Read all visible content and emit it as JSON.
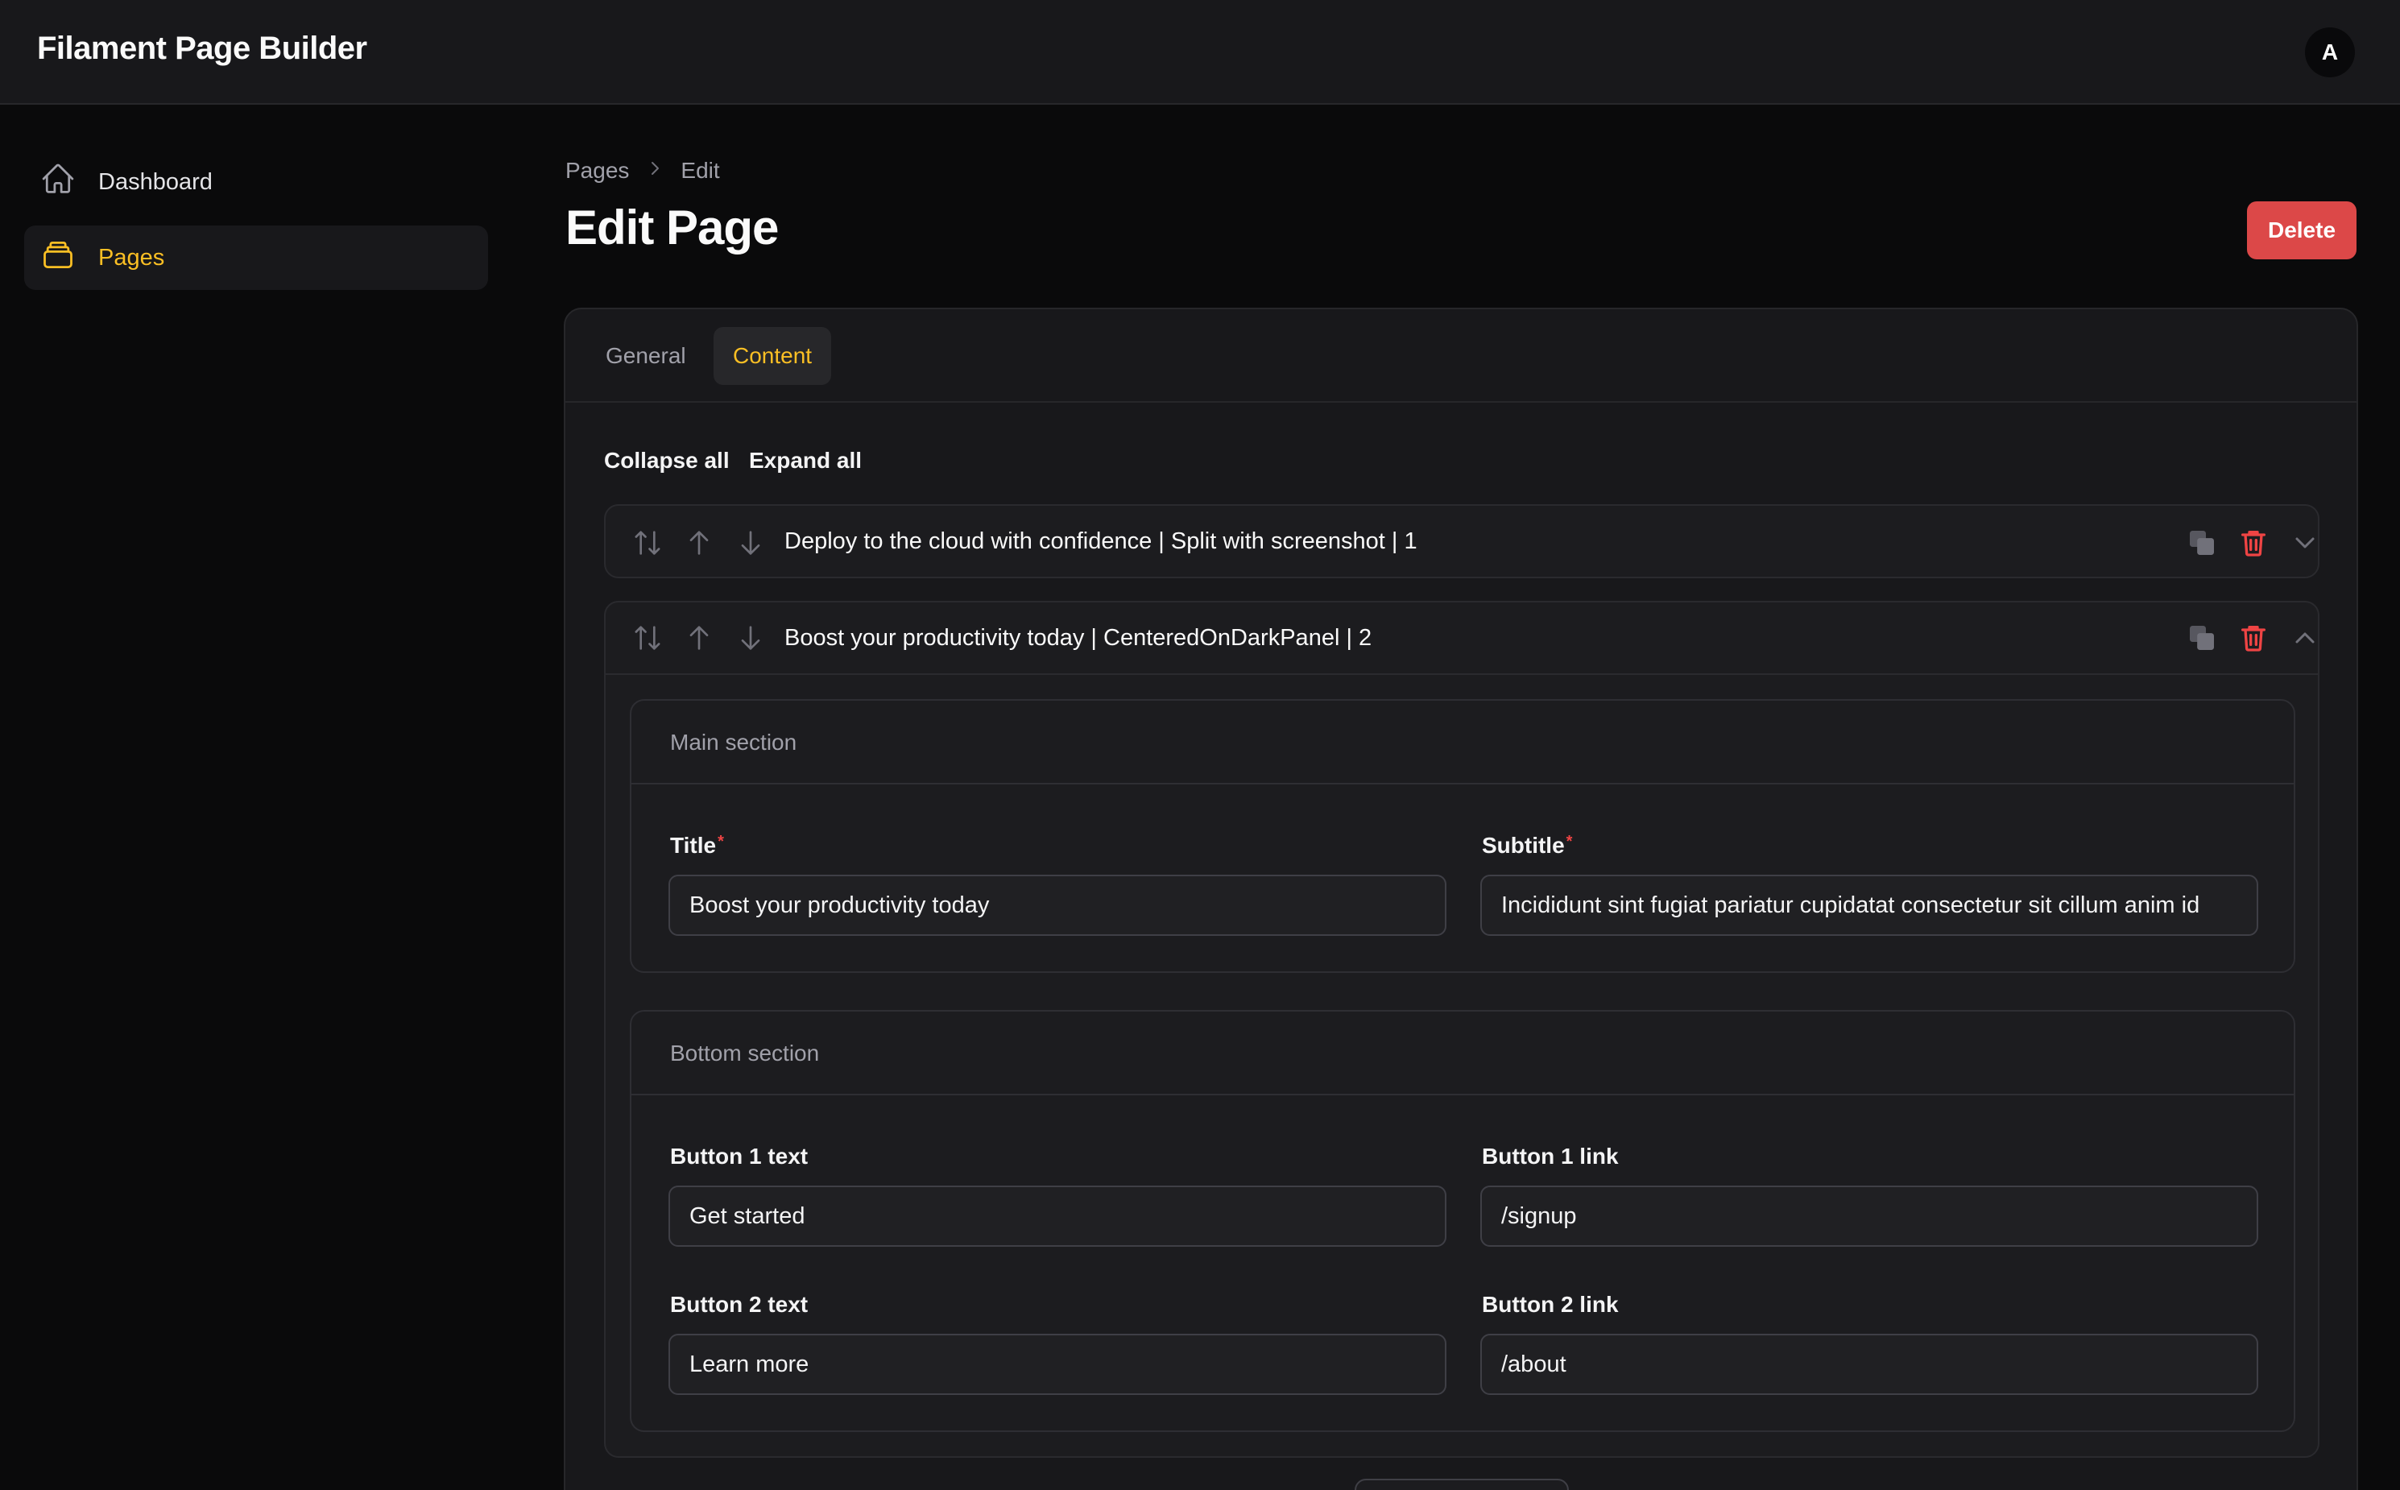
{
  "app": {
    "brand": "Filament Page Builder",
    "avatar_initial": "A"
  },
  "sidebar": {
    "items": [
      {
        "label": "Dashboard",
        "icon": "home-icon",
        "active": false
      },
      {
        "label": "Pages",
        "icon": "rectangle-stack-icon",
        "active": true
      }
    ]
  },
  "header": {
    "breadcrumb": [
      "Pages",
      "Edit"
    ],
    "title": "Edit Page",
    "delete_label": "Delete"
  },
  "tabs": [
    {
      "label": "General",
      "active": false
    },
    {
      "label": "Content",
      "active": true
    }
  ],
  "repeater": {
    "collapse_all": "Collapse all",
    "expand_all": "Expand all",
    "items": [
      {
        "label": "Deploy to the cloud with confidence | Split with screenshot | 1",
        "expanded": false
      },
      {
        "label": "Boost your productivity today | CenteredOnDarkPanel | 2",
        "expanded": true
      }
    ]
  },
  "main_section": {
    "title": "Main section",
    "fields": {
      "title": {
        "label": "Title",
        "value": "Boost your productivity today",
        "required": true
      },
      "subtitle": {
        "label": "Subtitle",
        "value": "Incididunt sint fugiat pariatur cupidatat consectetur sit cillum anim id",
        "required": true
      }
    }
  },
  "bottom_section": {
    "title": "Bottom section",
    "fields": {
      "button1_text": {
        "label": "Button 1 text",
        "value": "Get started"
      },
      "button1_link": {
        "label": "Button 1 link",
        "value": "/signup"
      },
      "button2_text": {
        "label": "Button 2 text",
        "value": "Learn more"
      },
      "button2_link": {
        "label": "Button 2 link",
        "value": "/about"
      }
    }
  },
  "colors": {
    "accent": "#fbbf24",
    "danger": "#dc4848",
    "background": "#0a0a0b",
    "panel": "#18181b"
  }
}
